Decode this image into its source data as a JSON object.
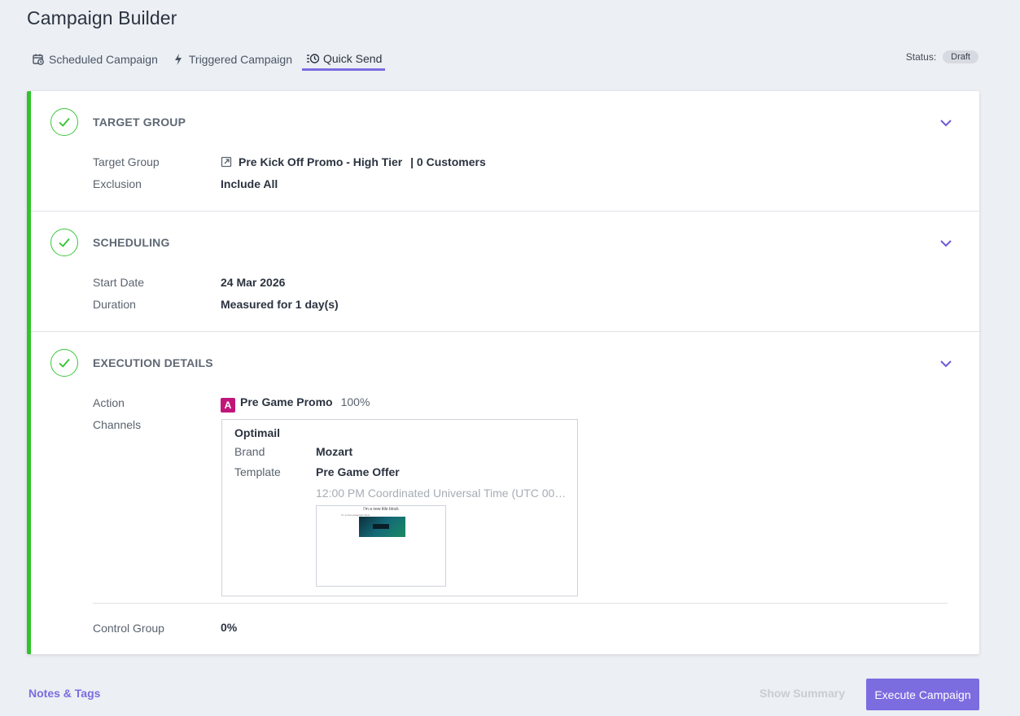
{
  "page": {
    "title": "Campaign Builder"
  },
  "tabs": [
    {
      "label": "Scheduled Campaign",
      "icon": "calendar-clock-icon"
    },
    {
      "label": "Triggered Campaign",
      "icon": "lightning-icon"
    },
    {
      "label": "Quick Send",
      "icon": "list-clock-icon",
      "active": true
    }
  ],
  "status": {
    "label": "Status:",
    "value": "Draft"
  },
  "sections": {
    "target_group": {
      "title": "TARGET GROUP",
      "rows": [
        {
          "label": "Target Group",
          "value": "Pre Kick Off Promo - High Tier",
          "suffix": "| 0 Customers"
        },
        {
          "label": "Exclusion",
          "value": "Include All"
        }
      ]
    },
    "scheduling": {
      "title": "SCHEDULING",
      "rows": [
        {
          "label": "Start Date",
          "value": "24 Mar 2026"
        },
        {
          "label": "Duration",
          "value": "Measured for 1 day(s)"
        }
      ]
    },
    "execution": {
      "title": "EXECUTION DETAILS",
      "action_label": "Action",
      "action_badge": "A",
      "action_value": "Pre Game Promo",
      "action_percent": "100%",
      "channels_label": "Channels",
      "channel": {
        "name": "Optimail",
        "brand_label": "Brand",
        "brand_value": "Mozart",
        "template_label": "Template",
        "template_value": "Pre Game Offer",
        "time": "12:00 PM Coordinated Universal Time (UTC 00:0...",
        "thumbnail_title": "I'm a new title block",
        "thumbnail_subtitle": "I'm a new paragraph block"
      },
      "control_label": "Control Group",
      "control_value": "0%"
    }
  },
  "footer": {
    "notes_link": "Notes & Tags",
    "show_summary": "Show Summary",
    "execute": "Execute Campaign"
  },
  "colors": {
    "accent": "#7b6ce0",
    "success": "#2fc42b",
    "action_badge": "#c0167a"
  }
}
